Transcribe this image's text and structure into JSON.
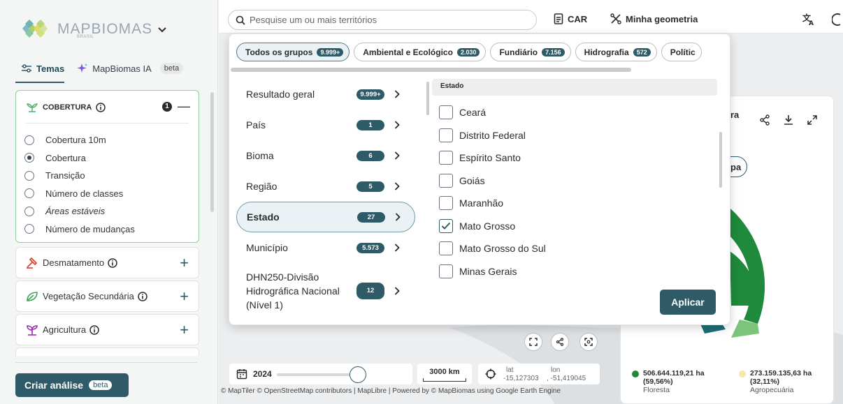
{
  "brand": {
    "name": "MAPBIOMAS",
    "subtitle": "BRASIL"
  },
  "tabs": [
    {
      "label": "Temas"
    },
    {
      "label": "MapBiomas IA",
      "badge": "beta"
    }
  ],
  "cobertura_card": {
    "title": "COBERTURA",
    "count": "1",
    "options": [
      {
        "label": "Cobertura 10m",
        "selected": false
      },
      {
        "label": "Cobertura",
        "selected": true
      },
      {
        "label": "Transição",
        "selected": false
      },
      {
        "label": "Número de classes",
        "selected": false
      },
      {
        "label": "Áreas estáveis",
        "selected": false
      },
      {
        "label": "Número de mudanças",
        "selected": false
      }
    ]
  },
  "layers": [
    {
      "label": "Desmatamento",
      "icon": "deforestation-icon"
    },
    {
      "label": "Vegetação Secundária",
      "icon": "leaf-icon"
    },
    {
      "label": "Agricultura",
      "icon": "sprout-icon"
    }
  ],
  "analysis_button": {
    "label": "Criar análise",
    "badge": "beta"
  },
  "topbar": {
    "search_placeholder": "Pesquise um ou mais territórios",
    "car_label": "CAR",
    "geometry_label": "Minha geometria"
  },
  "filter_pills": [
    {
      "label": "Todos os grupos",
      "count": "9.999+",
      "active": true
    },
    {
      "label": "Ambiental e Ecológico",
      "count": "2.030",
      "active": false
    },
    {
      "label": "Fundiário",
      "count": "7.156",
      "active": false
    },
    {
      "label": "Hidrografia",
      "count": "572",
      "active": false
    },
    {
      "label": "Polític",
      "count": "",
      "active": false
    }
  ],
  "categories": [
    {
      "label": "Resultado geral",
      "count": "9.999+",
      "active": false
    },
    {
      "label": "País",
      "count": "1",
      "active": false
    },
    {
      "label": "Bioma",
      "count": "6",
      "active": false
    },
    {
      "label": "Região",
      "count": "5",
      "active": false
    },
    {
      "label": "Estado",
      "count": "27",
      "active": true
    },
    {
      "label": "Município",
      "count": "5.573",
      "active": false
    },
    {
      "label": "DHN250-Divisão Hidrográfica Nacional (Nível 1)",
      "count": "12",
      "active": false
    }
  ],
  "state_panel": {
    "header": "Estado",
    "items": [
      {
        "label": "Ceará",
        "checked": false
      },
      {
        "label": "Distrito Federal",
        "checked": false
      },
      {
        "label": "Espírito Santo",
        "checked": false
      },
      {
        "label": "Goiás",
        "checked": false
      },
      {
        "label": "Maranhão",
        "checked": false
      },
      {
        "label": "Mato Grosso",
        "checked": true
      },
      {
        "label": "Mato Grosso do Sul",
        "checked": false
      },
      {
        "label": "Minas Gerais",
        "checked": false
      }
    ],
    "apply_label": "Aplicar"
  },
  "map": {
    "year": "2024",
    "scale": "3000 km",
    "lat_label": "lat",
    "lat_value": "-15,127303",
    "lon_label": "lon",
    "lon_value": ", -51,419045",
    "attribution": "© MapTiler © OpenStreetMap contributors | MapLibre | Powered by © MapBiomas using Google Earth Engine"
  },
  "right_panel": {
    "title_fragment": "ra",
    "chip_fragment": "pa",
    "legend": [
      {
        "value": "506.644.119,21 ha",
        "pct": "(59,56%)",
        "label": "Floresta",
        "color": "#1f8a3b"
      },
      {
        "value": "273.159.135,63 ha",
        "pct": "(32,11%)",
        "label": "Agropecuária",
        "color": "#f6e6a8"
      }
    ],
    "donut_colors": [
      "#1f8a3b",
      "#7cc47a",
      "#1c6f78"
    ]
  }
}
